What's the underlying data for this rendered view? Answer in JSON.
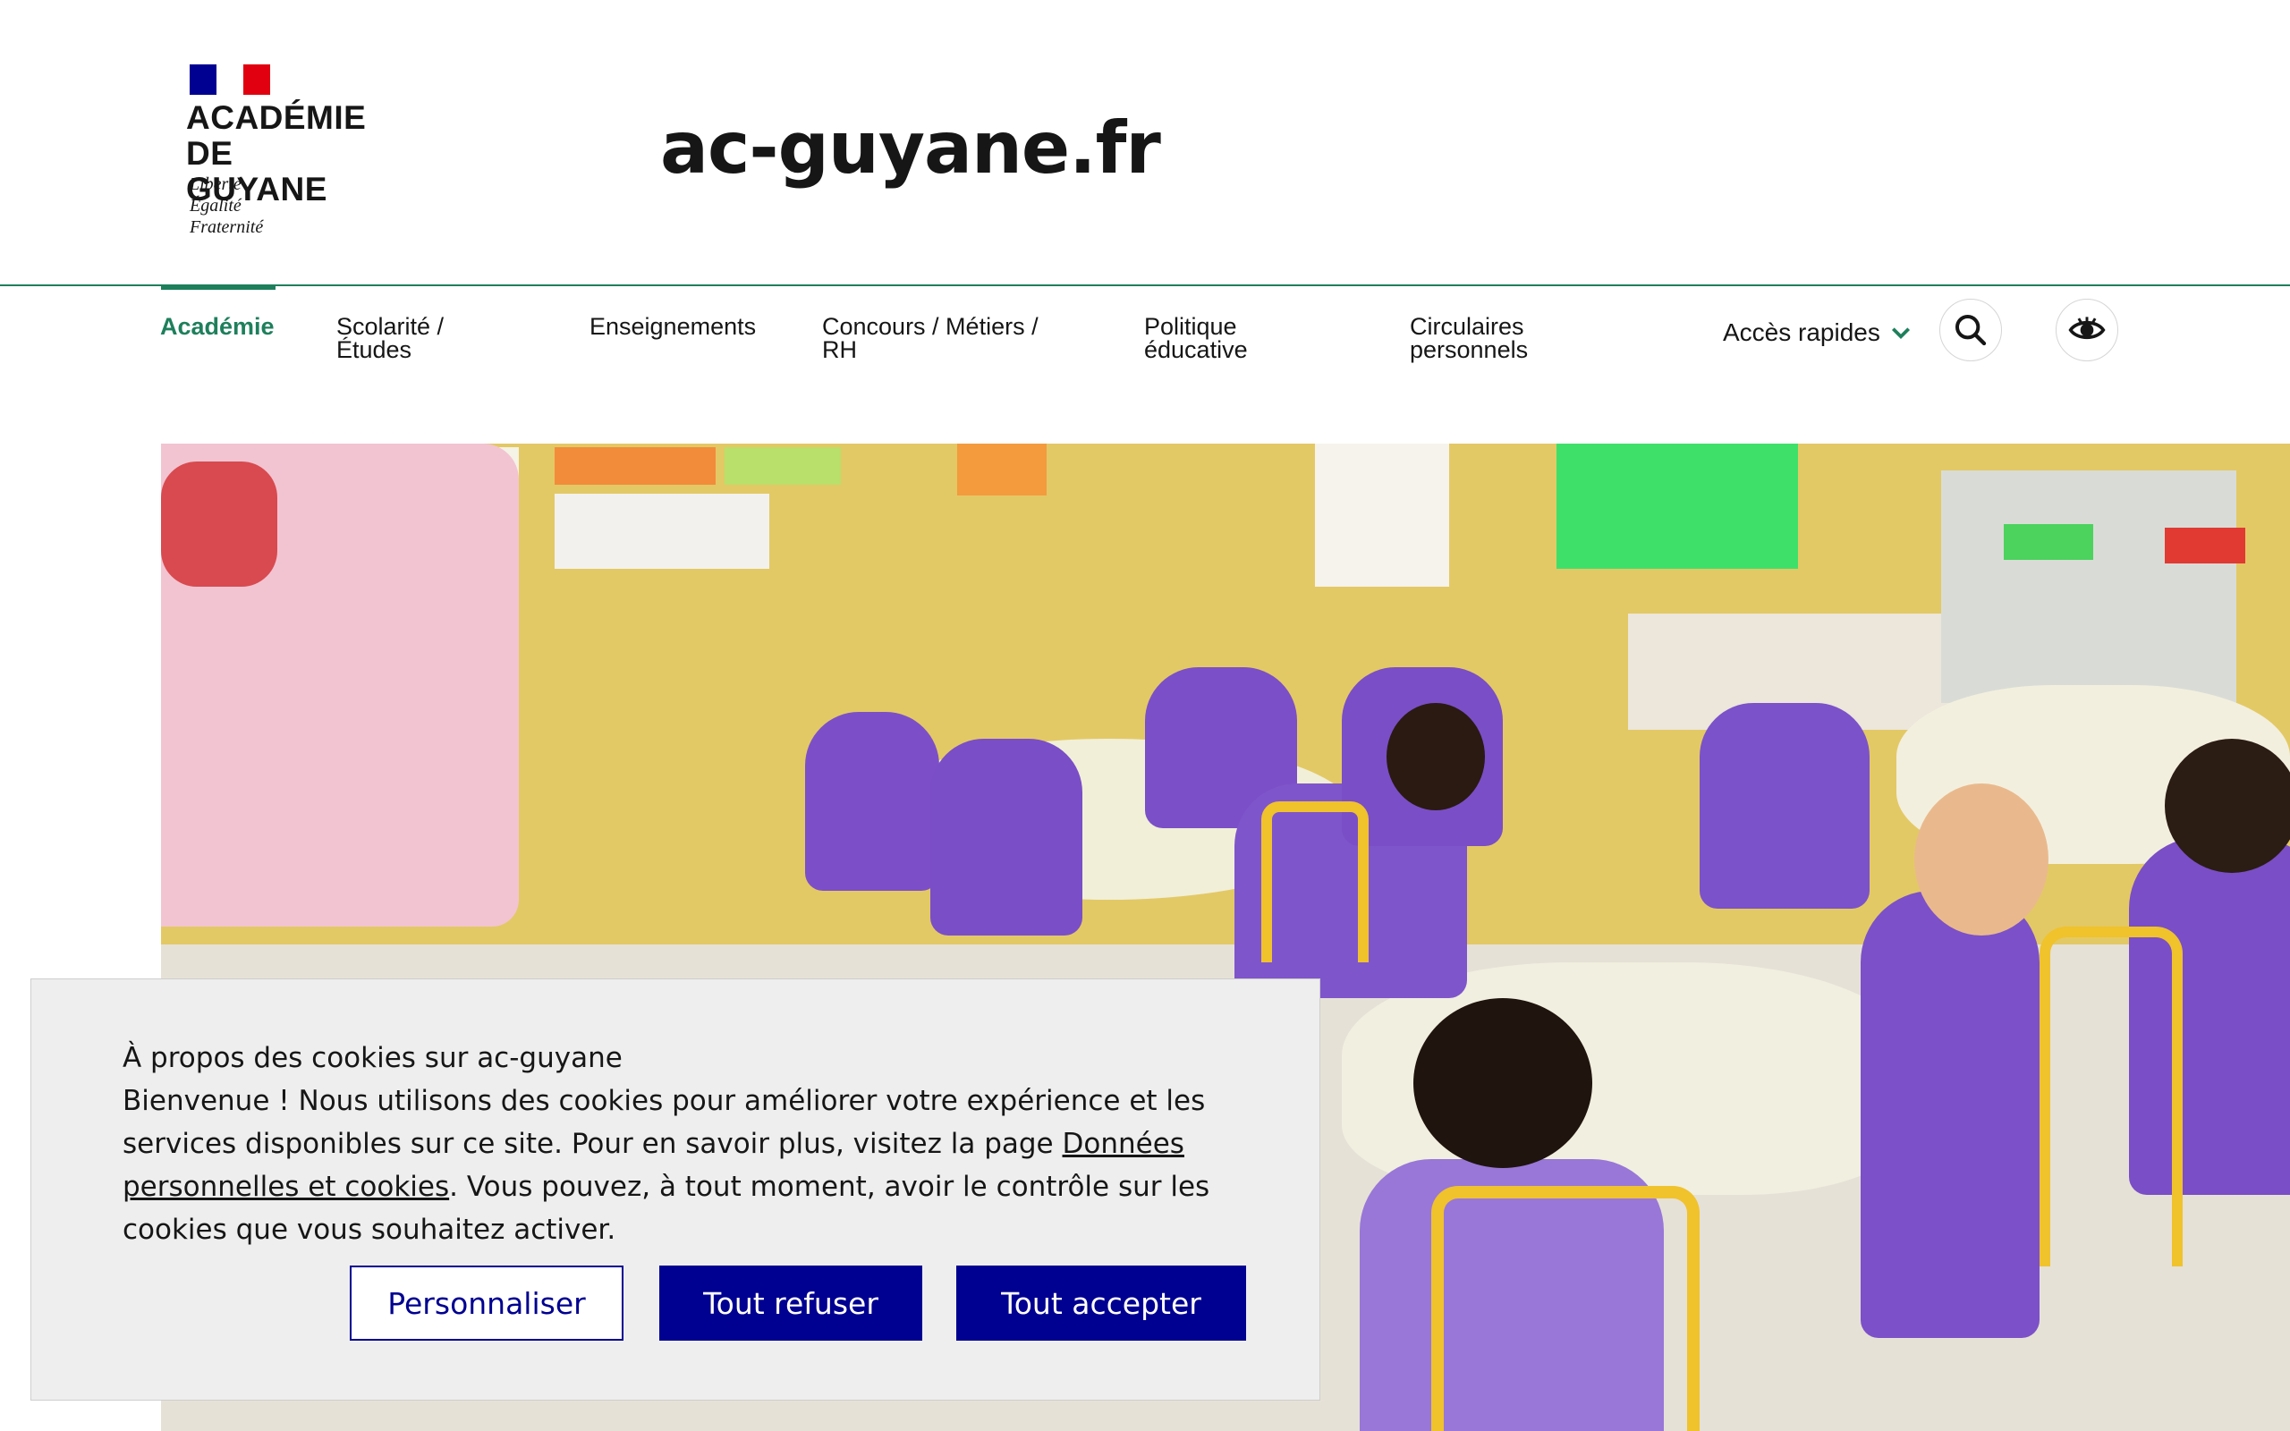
{
  "header": {
    "logo_text": "ACADÉMIE\nDE GUYANE",
    "motto": "Liberté\nÉgalité\nFraternité",
    "site_title": "ac-guyane.fr"
  },
  "nav": {
    "items": [
      {
        "label": "Académie",
        "active": true
      },
      {
        "label": "Scolarité /\nÉtudes"
      },
      {
        "label": "Enseignements"
      },
      {
        "label": "Concours / Métiers /\nRH"
      },
      {
        "label": "Politique\néducative"
      },
      {
        "label": "Circulaires\npersonnels"
      }
    ],
    "acces_rapides": "Accès rapides",
    "search_icon": "search-icon",
    "accessibility_icon": "eye-icon"
  },
  "hero": {
    "description_icon": "classroom-photo"
  },
  "cookie": {
    "title": "À propos des cookies sur ac-guyane",
    "body_1": "Bienvenue ! Nous utilisons des cookies pour améliorer votre expérience et les services disponibles sur ce site. Pour en savoir plus, visitez la page ",
    "link": "Données personnelles et cookies",
    "body_2": ". Vous pouvez, à tout moment, avoir le contrôle sur les cookies que vous souhaitez activer.",
    "personalize": "Personnaliser",
    "refuse": "Tout refuser",
    "accept": "Tout accepter"
  },
  "colors": {
    "accent": "#1e7f5c",
    "button": "#000091"
  }
}
